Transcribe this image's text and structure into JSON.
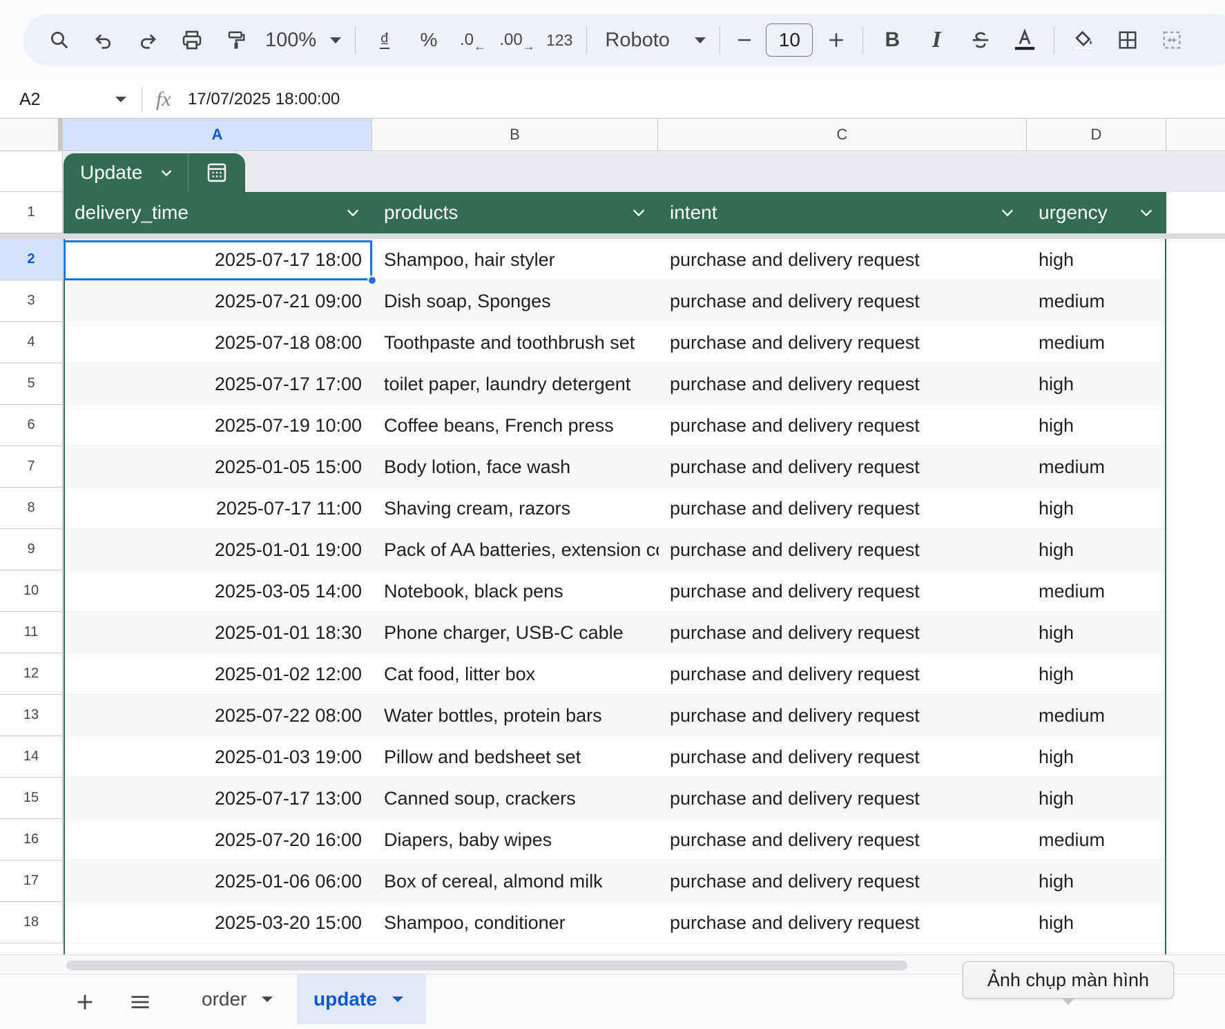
{
  "toolbar": {
    "zoom": "100%",
    "currency_label": "₫",
    "percent_label": "%",
    "decimal_decrease_label": ".0",
    "decimal_increase_label": ".00",
    "number_format_label": "123",
    "font_name": "Roboto",
    "font_size": "10",
    "icons": [
      "search-icon",
      "undo-icon",
      "redo-icon",
      "print-icon",
      "paint-format-icon",
      "zoom-dropdown",
      "currency-icon",
      "percent-icon",
      "decrease-decimal-icon",
      "increase-decimal-icon",
      "number-format-icon",
      "font-dropdown",
      "minus-icon",
      "plus-icon",
      "bold-icon",
      "italic-icon",
      "strikethrough-icon",
      "text-color-icon",
      "fill-color-icon",
      "borders-icon",
      "merge-icon"
    ]
  },
  "formula_bar": {
    "cell_ref": "A2",
    "fx": "fx",
    "value": "17/07/2025 18:00:00"
  },
  "columns": [
    "A",
    "B",
    "C",
    "D"
  ],
  "table": {
    "name": "Update",
    "headers": [
      "delivery_time",
      "products",
      "intent",
      "urgency"
    ],
    "rows": [
      {
        "n": "2",
        "delivery_time": "2025-07-17 18:00",
        "products": "Shampoo, hair styler",
        "intent": "purchase and delivery request",
        "urgency": "high"
      },
      {
        "n": "3",
        "delivery_time": "2025-07-21 09:00",
        "products": "Dish soap, Sponges",
        "intent": "purchase and delivery request",
        "urgency": "medium"
      },
      {
        "n": "4",
        "delivery_time": "2025-07-18 08:00",
        "products": "Toothpaste and toothbrush set",
        "intent": "purchase and delivery request",
        "urgency": "medium"
      },
      {
        "n": "5",
        "delivery_time": "2025-07-17 17:00",
        "products": "toilet paper, laundry detergent",
        "intent": "purchase and delivery request",
        "urgency": "high"
      },
      {
        "n": "6",
        "delivery_time": "2025-07-19 10:00",
        "products": "Coffee beans, French press",
        "intent": "purchase and delivery request",
        "urgency": "high"
      },
      {
        "n": "7",
        "delivery_time": "2025-01-05 15:00",
        "products": "Body lotion, face wash",
        "intent": "purchase and delivery request",
        "urgency": "medium"
      },
      {
        "n": "8",
        "delivery_time": "2025-07-17 11:00",
        "products": "Shaving cream, razors",
        "intent": "purchase and delivery request",
        "urgency": "high"
      },
      {
        "n": "9",
        "delivery_time": "2025-01-01 19:00",
        "products": "Pack of AA batteries, extension cc",
        "intent": "purchase and delivery request",
        "urgency": "high"
      },
      {
        "n": "10",
        "delivery_time": "2025-03-05 14:00",
        "products": "Notebook, black pens",
        "intent": "purchase and delivery request",
        "urgency": "medium"
      },
      {
        "n": "11",
        "delivery_time": "2025-01-01 18:30",
        "products": "Phone charger, USB-C cable",
        "intent": "purchase and delivery request",
        "urgency": "high"
      },
      {
        "n": "12",
        "delivery_time": "2025-01-02 12:00",
        "products": "Cat food, litter box",
        "intent": "purchase and delivery request",
        "urgency": "high"
      },
      {
        "n": "13",
        "delivery_time": "2025-07-22 08:00",
        "products": "Water bottles, protein bars",
        "intent": "purchase and delivery request",
        "urgency": "medium"
      },
      {
        "n": "14",
        "delivery_time": "2025-01-03 19:00",
        "products": "Pillow and bedsheet set",
        "intent": "purchase and delivery request",
        "urgency": "high"
      },
      {
        "n": "15",
        "delivery_time": "2025-07-17 13:00",
        "products": "Canned soup, crackers",
        "intent": "purchase and delivery request",
        "urgency": "high"
      },
      {
        "n": "16",
        "delivery_time": "2025-07-20 16:00",
        "products": "Diapers, baby wipes",
        "intent": "purchase and delivery request",
        "urgency": "medium"
      },
      {
        "n": "17",
        "delivery_time": "2025-01-06 06:00",
        "products": "Box of cereal, almond milk",
        "intent": "purchase and delivery request",
        "urgency": "high"
      },
      {
        "n": "18",
        "delivery_time": "2025-03-20 15:00",
        "products": "Shampoo, conditioner",
        "intent": "purchase and delivery request",
        "urgency": "high"
      }
    ]
  },
  "header_row_number": "1",
  "sheets": {
    "tabs": [
      {
        "label": "order",
        "active": false
      },
      {
        "label": "update",
        "active": true
      }
    ]
  },
  "tooltip": "Ảnh chụp màn hình",
  "colors": {
    "table_header": "#346b55",
    "selection": "#1a73e8",
    "active_tab": "#0b57d0"
  }
}
